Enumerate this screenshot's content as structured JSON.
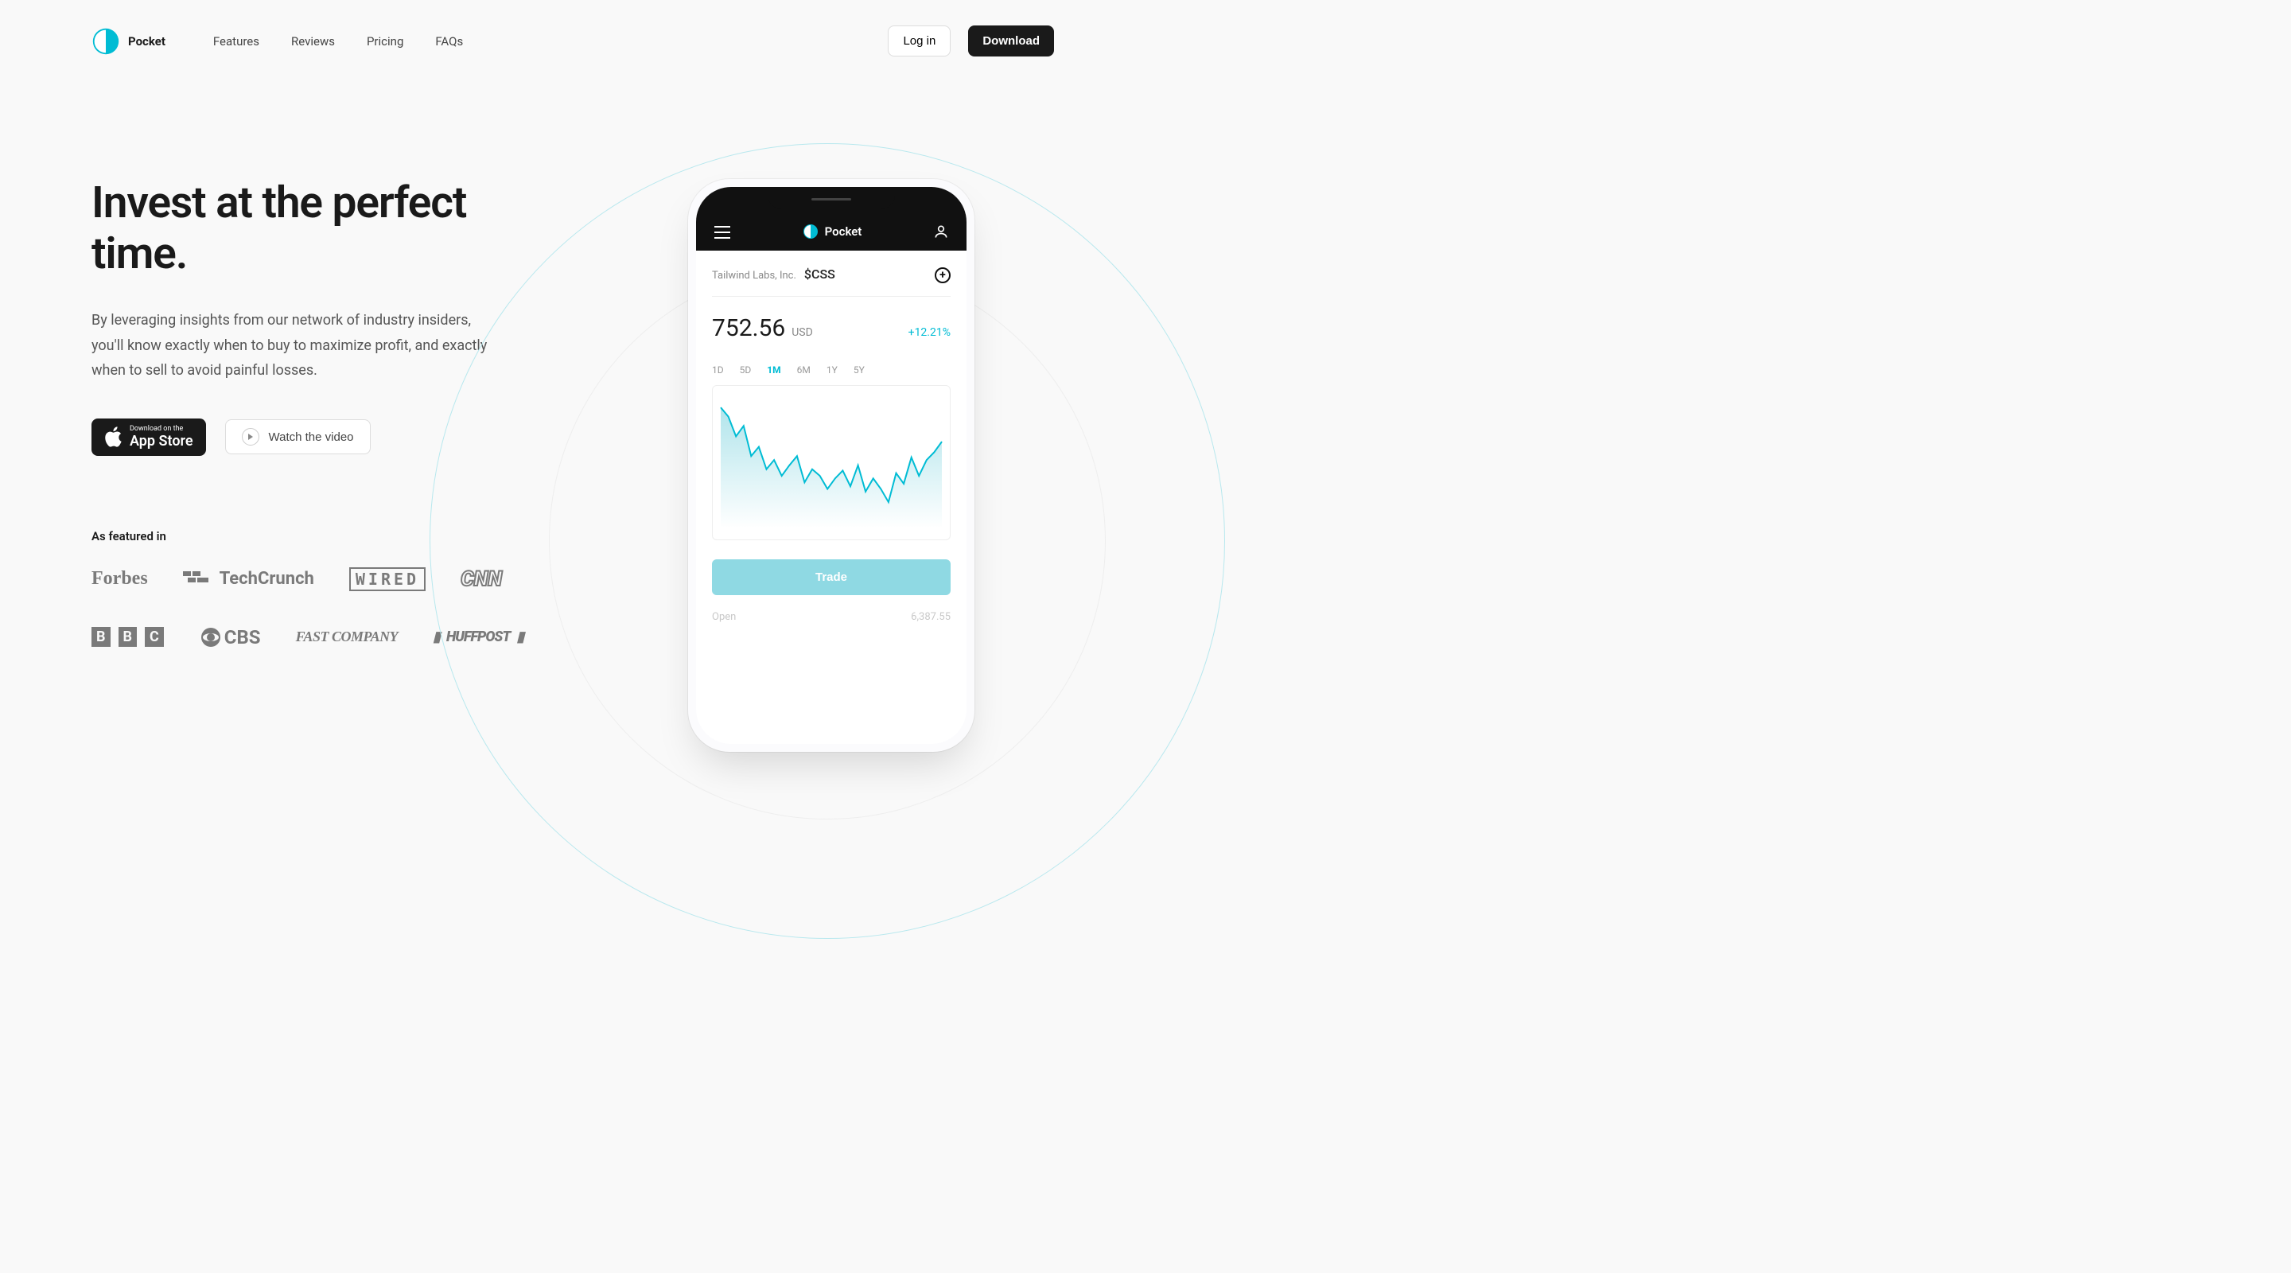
{
  "brand": "Pocket",
  "nav": [
    "Features",
    "Reviews",
    "Pricing",
    "FAQs"
  ],
  "header": {
    "login": "Log in",
    "download": "Download"
  },
  "hero": {
    "title": "Invest at the perfect time.",
    "subtitle": "By leveraging insights from our network of industry insiders, you'll know exactly when to buy to maximize profit, and exactly when to sell to avoid painful losses.",
    "appstore_overline": "Download on the",
    "appstore_label": "App Store",
    "watch_label": "Watch the video"
  },
  "featured": {
    "label": "As featured in",
    "logos": [
      "Forbes",
      "TechCrunch",
      "WIRED",
      "CNN",
      "BBC",
      "CBS",
      "FAST COMPANY",
      "HUFFPOST"
    ]
  },
  "phone": {
    "app_name": "Pocket",
    "company": "Tailwind Labs, Inc.",
    "ticker": "$CSS",
    "price": "752.56",
    "currency": "USD",
    "change": "+12.21%",
    "periods": [
      "1D",
      "5D",
      "1M",
      "6M",
      "1Y",
      "5Y"
    ],
    "active_period": "1M",
    "trade_label": "Trade",
    "open_label": "Open",
    "open_value": "6,387.55"
  },
  "chart_data": {
    "type": "line",
    "period": "1M",
    "values": [
      92,
      85,
      70,
      78,
      55,
      62,
      45,
      52,
      40,
      48,
      55,
      35,
      45,
      40,
      30,
      38,
      44,
      32,
      48,
      28,
      38,
      30,
      20,
      42,
      34,
      54,
      40,
      52,
      58,
      66
    ],
    "ylim": [
      0,
      100
    ]
  }
}
